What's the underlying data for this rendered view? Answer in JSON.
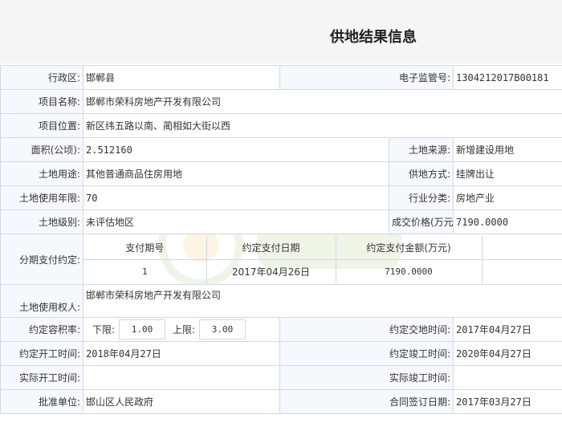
{
  "page": {
    "title": "供地结果信息"
  },
  "fields": {
    "district_label": "行政区:",
    "district": "邯郸县",
    "supervision_label": "电子监管号:",
    "supervision_no": "1304212017B00181",
    "project_name_label": "项目名称:",
    "project_name": "邯郸市荣科房地产开发有限公司",
    "project_location_label": "项目位置:",
    "project_location": "新区纬五路以南、蔺相如大街以西",
    "area_label": "面积(公顷):",
    "area": "2.512160",
    "land_source_label": "土地来源:",
    "land_source": "新增建设用地",
    "land_use_label": "土地用途:",
    "land_use": "其他普通商品住房用地",
    "supply_method_label": "供地方式:",
    "supply_method": "挂牌出让",
    "use_years_label": "土地使用年限:",
    "use_years": "70",
    "industry_label": "行业分类:",
    "industry": "房地产业",
    "land_grade_label": "土地级别:",
    "land_grade": "未评估地区",
    "price_label": "成交价格(万元):",
    "price": "7190.0000",
    "installment_label": "分期支付约定:",
    "installment_headers": [
      "支付期号",
      "约定支付日期",
      "约定支付金额(万元)"
    ],
    "installment_rows": [
      {
        "period": "1",
        "date": "2017年04月26日",
        "amount": "7190.0000"
      }
    ],
    "land_user_label": "土地使用权人:",
    "land_user": "邯郸市荣科房地产开发有限公司",
    "far_label": "约定容积率:",
    "far_lower_label": "下限:",
    "far_lower": "1.00",
    "far_upper_label": "上限:",
    "far_upper": "3.00",
    "handover_label": "约定交地时间:",
    "handover_date": "2017年04月27日",
    "start_label": "约定开工时间:",
    "start_date": "2018年04月27日",
    "finish_label": "约定竣工时间:",
    "finish_date": "2020年04月27日",
    "actual_start_label": "实际开工时间:",
    "actual_start": "",
    "actual_finish_label": "实际竣工时间:",
    "actual_finish": "",
    "approval_label": "批准单位:",
    "approval_unit": "邯山区人民政府",
    "contract_label": "合同签订日期:",
    "contract_date": "2017年03月27日"
  }
}
